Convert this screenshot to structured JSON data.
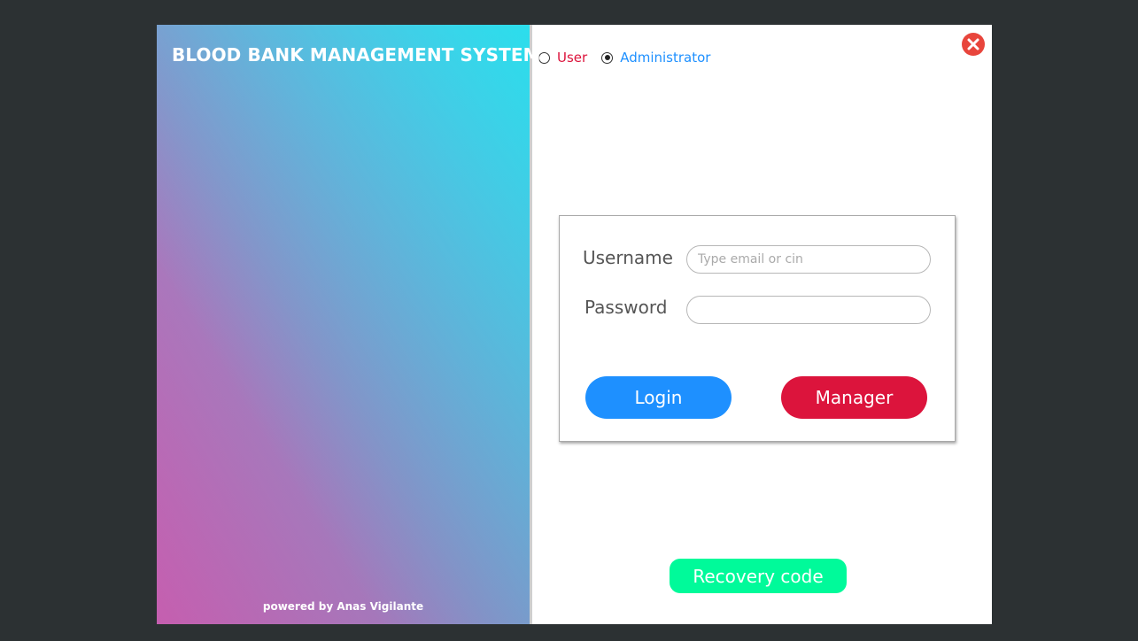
{
  "app": {
    "title": "BLOOD BANK MANAGEMENT SYSTEM",
    "powered_by": "powered by Anas Vigilante"
  },
  "role_selector": {
    "options": [
      {
        "label": "User",
        "selected": false,
        "color": "#dc143c"
      },
      {
        "label": "Administrator",
        "selected": true,
        "color": "#1e90ff"
      }
    ]
  },
  "close_button": {
    "icon": "close-icon",
    "color": "#e8453c"
  },
  "login_form": {
    "username_label": "Username",
    "username_placeholder": "Type email or cin",
    "username_value": "",
    "password_label": "Password",
    "password_value": "",
    "login_label": "Login",
    "manager_label": "Manager"
  },
  "recovery": {
    "label": "Recovery code"
  },
  "colors": {
    "login_button": "#1e90ff",
    "manager_button": "#dc143c",
    "recovery_button": "#00fa9a",
    "background": "#2c3133"
  }
}
